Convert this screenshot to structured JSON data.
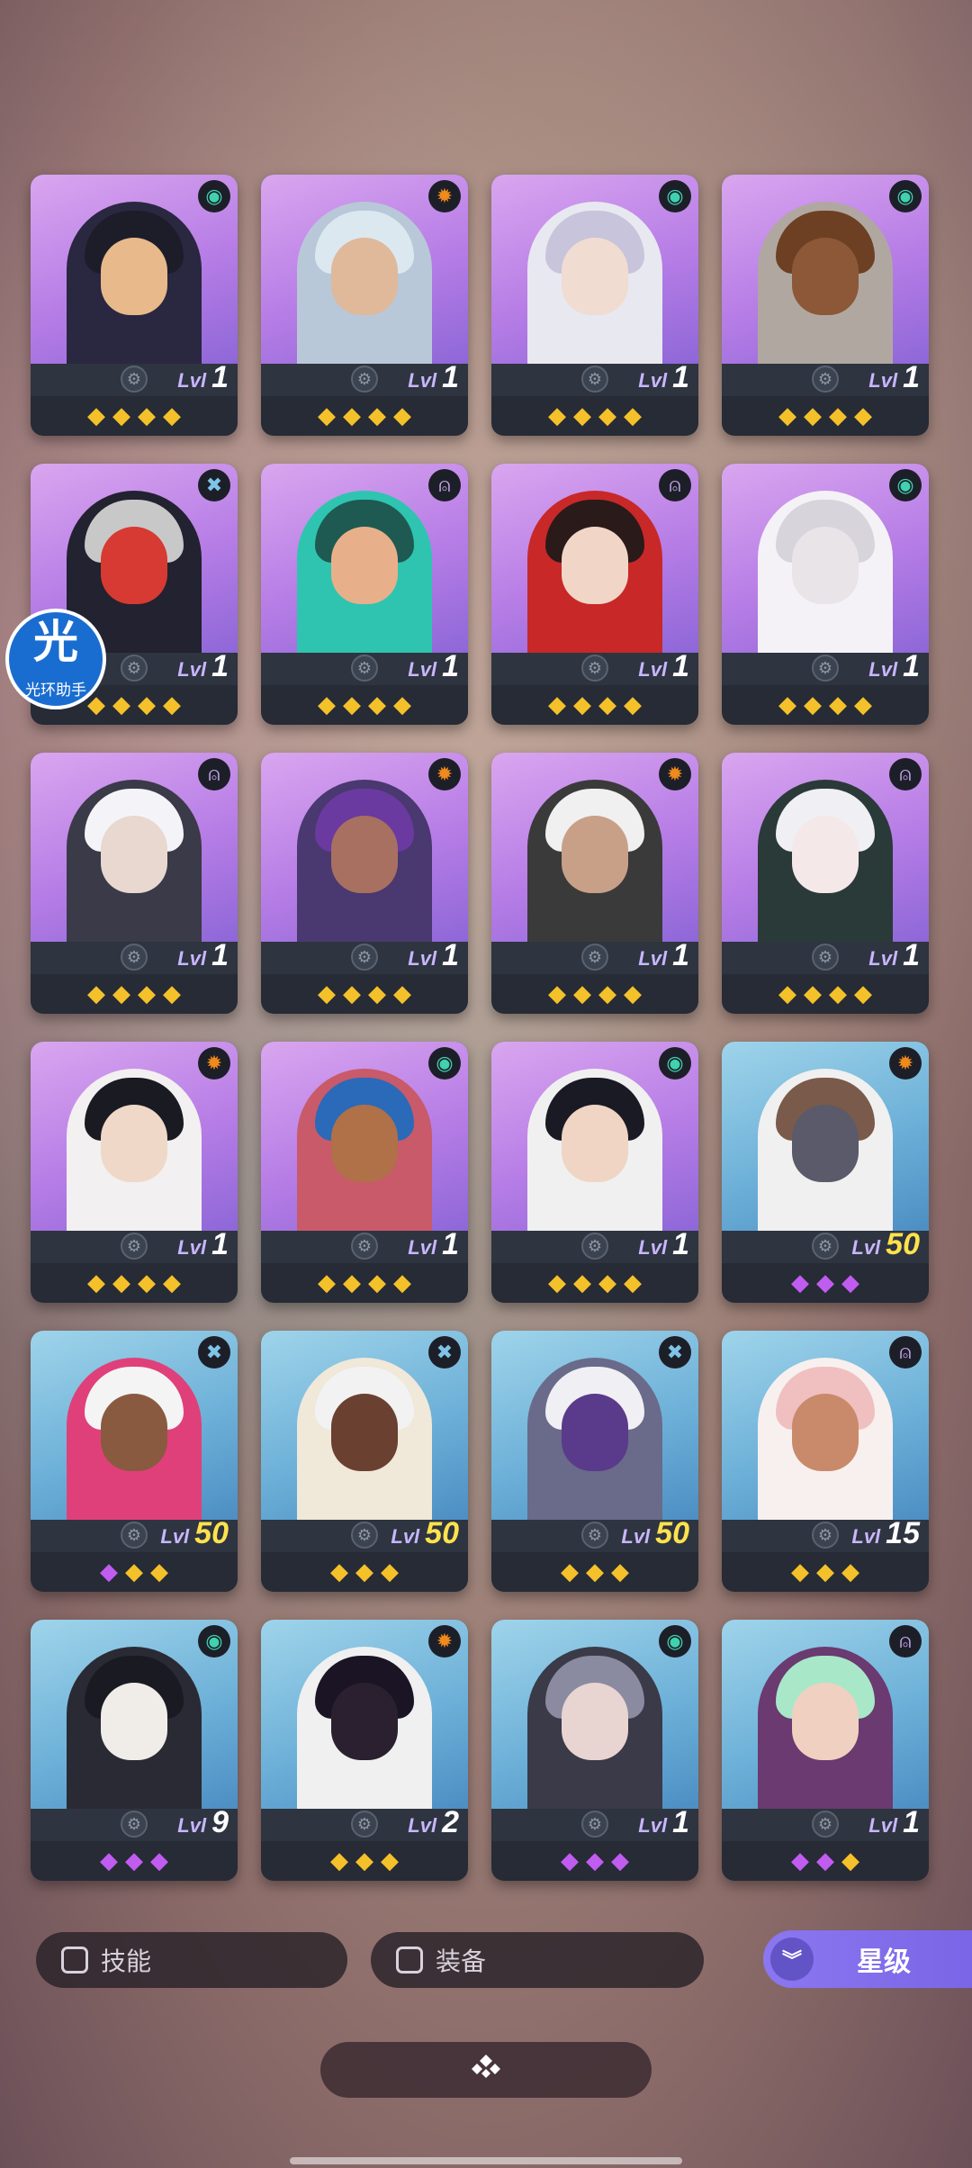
{
  "colors": {
    "gold_gem": "#f4c12a",
    "purple_gem": "#c15cf0",
    "star_button": "#7a66e6"
  },
  "level_prefix": "Lvl",
  "heroes": [
    {
      "role": "swirl",
      "role_icon": "spiral-icon",
      "level": "1",
      "bg": "purple",
      "gems": [
        "g",
        "g",
        "g",
        "g"
      ],
      "skin": "#e8b98a",
      "hair": "#1d1d2a",
      "body": "#2a2740"
    },
    {
      "role": "sun",
      "role_icon": "sun-icon",
      "level": "1",
      "bg": "purple",
      "gems": [
        "g",
        "g",
        "g",
        "g"
      ],
      "skin": "#e0b89a",
      "hair": "#dbe8f0",
      "body": "#b8c8d8"
    },
    {
      "role": "swirl",
      "role_icon": "spiral-icon",
      "level": "1",
      "bg": "purple",
      "gems": [
        "g",
        "g",
        "g",
        "g"
      ],
      "skin": "#f0dcd0",
      "hair": "#c7c4dc",
      "body": "#e8e8f0"
    },
    {
      "role": "swirl",
      "role_icon": "spiral-icon",
      "level": "1",
      "bg": "purple",
      "gems": [
        "g",
        "g",
        "g",
        "g"
      ],
      "skin": "#8c5838",
      "hair": "#6d4024",
      "body": "#b0a8a0"
    },
    {
      "role": "cross",
      "role_icon": "cross-icon",
      "level": "1",
      "bg": "purple",
      "gems": [
        "g",
        "g",
        "g",
        "g"
      ],
      "skin": "#d63a32",
      "hair": "#c8c8c8",
      "body": "#222230"
    },
    {
      "role": "drop",
      "role_icon": "drop-icon",
      "level": "1",
      "bg": "purple",
      "gems": [
        "g",
        "g",
        "g",
        "g"
      ],
      "skin": "#e8b08a",
      "hair": "#1e5a52",
      "body": "#2fc4b0"
    },
    {
      "role": "drop",
      "role_icon": "drop-icon",
      "level": "1",
      "bg": "purple",
      "gems": [
        "g",
        "g",
        "g",
        "g"
      ],
      "skin": "#f1d6c8",
      "hair": "#2a1a1a",
      "body": "#c82828"
    },
    {
      "role": "swirl",
      "role_icon": "spiral-icon",
      "level": "1",
      "bg": "purple",
      "gems": [
        "g",
        "g",
        "g",
        "g"
      ],
      "skin": "#e8e4e8",
      "hair": "#d8d4dc",
      "body": "#f4f2f6"
    },
    {
      "role": "drop",
      "role_icon": "drop-icon",
      "level": "1",
      "bg": "purple",
      "gems": [
        "g",
        "g",
        "g",
        "g"
      ],
      "skin": "#e8d8d0",
      "hair": "#f4f4f8",
      "body": "#3a3a48"
    },
    {
      "role": "sun",
      "role_icon": "sun-icon",
      "level": "1",
      "bg": "purple",
      "gems": [
        "g",
        "g",
        "g",
        "g"
      ],
      "skin": "#a87060",
      "hair": "#6a3aa0",
      "body": "#4a3870"
    },
    {
      "role": "sun",
      "role_icon": "sun-icon",
      "level": "1",
      "bg": "purple",
      "gems": [
        "g",
        "g",
        "g",
        "g"
      ],
      "skin": "#c8a088",
      "hair": "#f0f0f0",
      "body": "#3a3a3a"
    },
    {
      "role": "drop",
      "role_icon": "drop-icon",
      "level": "1",
      "bg": "purple",
      "gems": [
        "g",
        "g",
        "g",
        "g"
      ],
      "skin": "#f4e8e8",
      "hair": "#f0f0f4",
      "body": "#2a3a38"
    },
    {
      "role": "sun",
      "role_icon": "sun-icon",
      "level": "1",
      "bg": "purple",
      "gems": [
        "g",
        "g",
        "g",
        "g"
      ],
      "skin": "#f0d8c8",
      "hair": "#1a1a22",
      "body": "#f2f0f0"
    },
    {
      "role": "swirl",
      "role_icon": "spiral-icon",
      "level": "1",
      "bg": "purple",
      "gems": [
        "g",
        "g",
        "g",
        "g"
      ],
      "skin": "#b07048",
      "hair": "#2a6ab8",
      "body": "#c85a6a"
    },
    {
      "role": "swirl",
      "role_icon": "spiral-icon",
      "level": "1",
      "bg": "purple",
      "gems": [
        "g",
        "g",
        "g",
        "g"
      ],
      "skin": "#f0d4c4",
      "hair": "#1a1a24",
      "body": "#f0f0f0"
    },
    {
      "role": "sun",
      "role_icon": "sun-icon",
      "level": "50",
      "bg": "blue",
      "gems": [
        "p",
        "p",
        "p"
      ],
      "skin": "#5a5a6a",
      "hair": "#7a5a4a",
      "body": "#f0f0f0"
    },
    {
      "role": "cross",
      "role_icon": "cross-icon",
      "level": "50",
      "bg": "blue",
      "gems": [
        "p",
        "g",
        "g"
      ],
      "skin": "#8a5a40",
      "hair": "#f4f4f4",
      "body": "#e0407a"
    },
    {
      "role": "cross",
      "role_icon": "cross-icon",
      "level": "50",
      "bg": "blue",
      "gems": [
        "g",
        "g",
        "g"
      ],
      "skin": "#6a4030",
      "hair": "#f2f2f2",
      "body": "#f0e8d8"
    },
    {
      "role": "cross",
      "role_icon": "cross-icon",
      "level": "50",
      "bg": "blue",
      "gems": [
        "g",
        "g",
        "g"
      ],
      "skin": "#5a3a8a",
      "hair": "#f0f0f4",
      "body": "#6a6a8a"
    },
    {
      "role": "drop",
      "role_icon": "drop-icon",
      "level": "15",
      "bg": "blue",
      "gems": [
        "g",
        "g",
        "g"
      ],
      "skin": "#c88a6a",
      "hair": "#f0c0c0",
      "body": "#f8f0ee"
    },
    {
      "role": "swirl",
      "role_icon": "spiral-icon",
      "level": "9",
      "bg": "blue",
      "gems": [
        "p",
        "p",
        "p"
      ],
      "skin": "#f0ece8",
      "hair": "#1a1a22",
      "body": "#2a2a34"
    },
    {
      "role": "sun",
      "role_icon": "sun-icon",
      "level": "2",
      "bg": "blue",
      "gems": [
        "g",
        "g",
        "g"
      ],
      "skin": "#2a2030",
      "hair": "#1a1424",
      "body": "#f0f0f0"
    },
    {
      "role": "swirl",
      "role_icon": "spiral-icon",
      "level": "1",
      "bg": "blue",
      "gems": [
        "p",
        "p",
        "p"
      ],
      "skin": "#e8d4d0",
      "hair": "#8a8aa0",
      "body": "#3a3a48"
    },
    {
      "role": "drop",
      "role_icon": "drop-icon",
      "level": "1",
      "bg": "blue",
      "gems": [
        "p",
        "p",
        "g"
      ],
      "skin": "#f0d0c0",
      "hair": "#a8e8c8",
      "body": "#6a3a70"
    }
  ],
  "floating_badge": {
    "char": "光",
    "label": "光环助手"
  },
  "filters": {
    "skill_label": "技能",
    "equip_label": "装备",
    "star_label": "星级"
  }
}
